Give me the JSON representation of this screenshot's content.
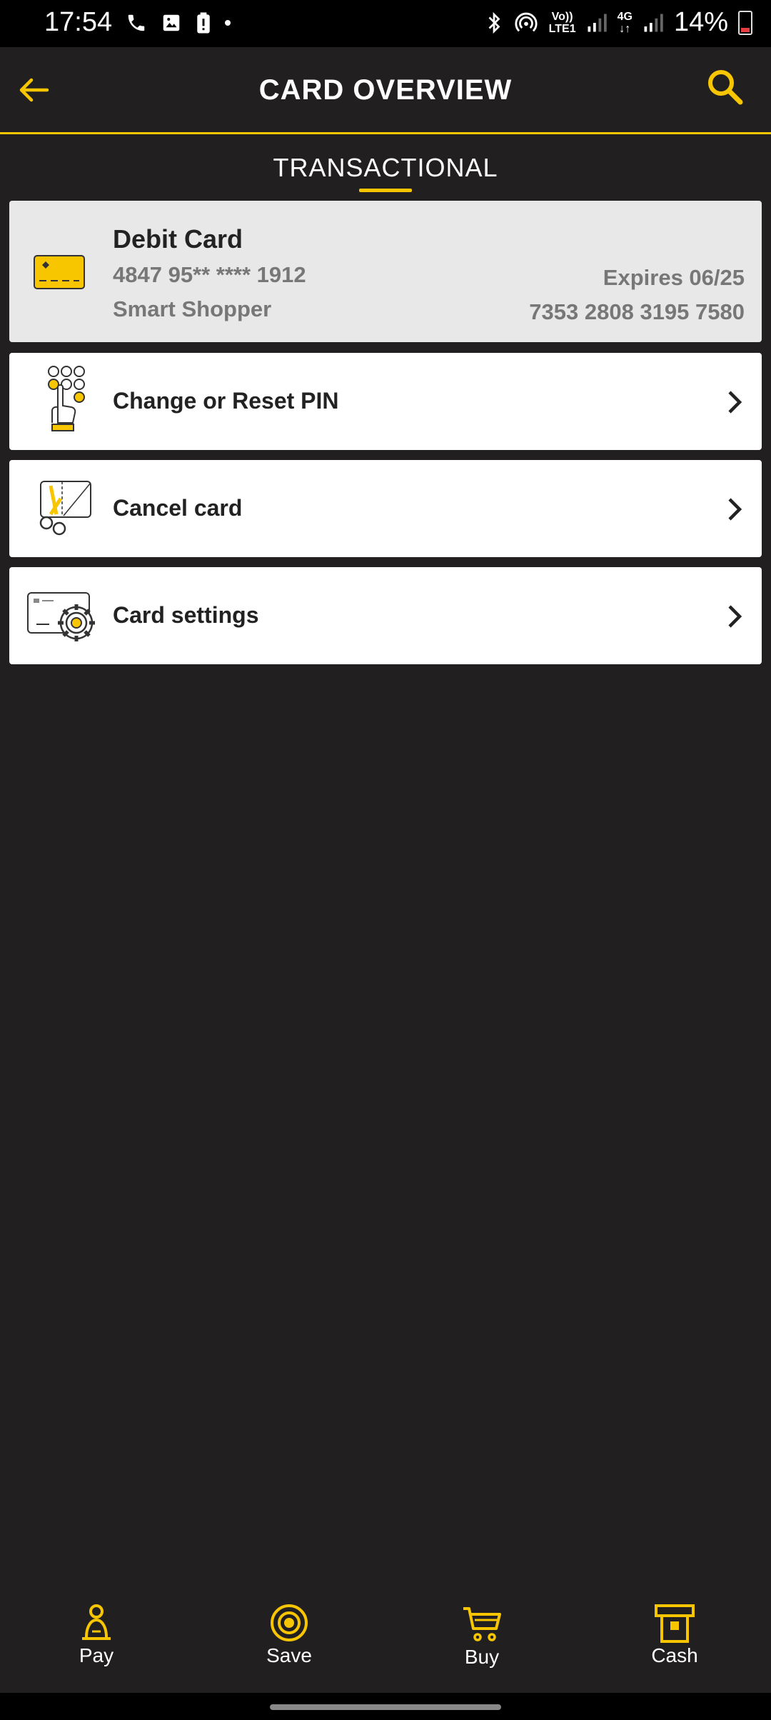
{
  "status_bar": {
    "time": "17:54",
    "network_line1": "Vo))",
    "network_line2": "LTE1",
    "data_line1": "4G",
    "data_line2": "↓↑",
    "battery_percent": "14%"
  },
  "header": {
    "title": "CARD OVERVIEW",
    "accent_color": "#f7c600"
  },
  "tabs": [
    {
      "label": "TRANSACTIONAL",
      "active": true
    }
  ],
  "card": {
    "title": "Debit Card",
    "number": "4847 95** **** 1912",
    "plan": "Smart Shopper",
    "expiry": "Expires 06/25",
    "account_number": "7353 2808 3195 7580"
  },
  "menu": [
    {
      "label": "Change or Reset PIN",
      "icon": "pin-keypad-icon"
    },
    {
      "label": "Cancel card",
      "icon": "scissors-card-icon"
    },
    {
      "label": "Card settings",
      "icon": "card-gear-icon"
    }
  ],
  "bottom_nav": [
    {
      "label": "Pay",
      "icon": "pay-icon"
    },
    {
      "label": "Save",
      "icon": "save-target-icon"
    },
    {
      "label": "Buy",
      "icon": "cart-icon"
    },
    {
      "label": "Cash",
      "icon": "atm-cash-icon"
    }
  ]
}
